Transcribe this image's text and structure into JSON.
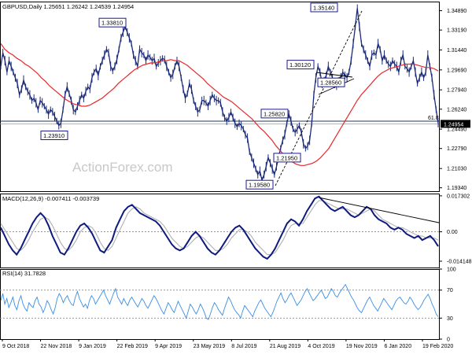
{
  "symbol_header": "GBPUSD,Daily  1.25651 1.26242 1.24539 1.24954",
  "watermark": "ActionForex.com",
  "colors": {
    "price": "#1c2b7a",
    "ma": "#e8272a",
    "macd": "#0d1a80",
    "signal": "#b0b0b0",
    "rsi": "#3a8ee6",
    "trendline": "#000000",
    "level_line": "#1c3a5a"
  },
  "chart_data": [
    {
      "type": "line",
      "pane": "price",
      "x_labels": [
        "9 Oct 2018",
        "22 Nov 2018",
        "9 Jan 2019",
        "22 Feb 2019",
        "9 Apr 2019",
        "23 May 2019",
        "8 Jul 2019",
        "21 Aug 2019",
        "4 Oct 2019",
        "19 Nov 2019",
        "6 Jan 2020",
        "19 Feb 2020"
      ],
      "y_ticks": [
        1.3489,
        1.3319,
        1.3144,
        1.2969,
        1.2794,
        1.2624,
        1.2449,
        1.2279,
        1.2103,
        1.1934
      ],
      "y_tick_labels": [
        "1.34890",
        "1.33190",
        "1.31440",
        "1.29690",
        "1.27940",
        "1.26240",
        "1.24490",
        "1.22790",
        "1.21030",
        "1.19340"
      ],
      "ylim": [
        1.1904,
        1.3569
      ],
      "current_price": "1.24954",
      "current_value": 1.24954,
      "series": [
        {
          "name": "",
          "values": [
            1.3,
            1.312,
            1.305,
            1.295,
            1.305,
            1.3,
            1.295,
            1.29,
            1.285,
            1.275,
            1.28,
            1.288,
            1.282,
            1.278,
            1.275,
            1.27,
            1.272,
            1.268,
            1.262,
            1.27,
            1.268,
            1.265,
            1.262,
            1.258,
            1.262,
            1.26,
            1.256,
            1.252,
            1.248,
            1.25,
            1.262,
            1.275,
            1.282,
            1.276,
            1.27,
            1.262,
            1.26,
            1.265,
            1.27,
            1.275,
            1.272,
            1.278,
            1.282,
            1.28,
            1.29,
            1.295,
            1.298,
            1.292,
            1.3,
            1.305,
            1.31,
            1.315,
            1.312,
            1.3,
            1.296,
            1.3,
            1.306,
            1.315,
            1.325,
            1.33,
            1.335,
            1.33,
            1.325,
            1.32,
            1.31,
            1.305,
            1.3,
            1.315,
            1.312,
            1.31,
            1.305,
            1.31,
            1.308,
            1.305,
            1.307,
            1.3,
            1.303,
            1.305,
            1.307,
            1.306,
            1.3,
            1.295,
            1.29,
            1.293,
            1.3,
            1.305,
            1.3,
            1.29,
            1.28,
            1.272,
            1.276,
            1.285,
            1.28,
            1.27,
            1.265,
            1.26,
            1.262,
            1.27,
            1.27,
            1.268,
            1.265,
            1.27,
            1.275,
            1.272,
            1.27,
            1.27,
            1.268,
            1.26,
            1.255,
            1.252,
            1.255,
            1.26,
            1.255,
            1.25,
            1.247,
            1.25,
            1.248,
            1.245,
            1.24,
            1.237,
            1.225,
            1.22,
            1.215,
            1.21,
            1.205,
            1.208,
            1.2,
            1.205,
            1.212,
            1.22,
            1.215,
            1.21,
            1.205,
            1.212,
            1.22,
            1.228,
            1.235,
            1.24,
            1.25,
            1.258,
            1.252,
            1.245,
            1.242,
            1.245,
            1.248,
            1.242,
            1.232,
            1.228,
            1.23,
            1.235,
            1.25,
            1.275,
            1.29,
            1.3,
            1.295,
            1.285,
            1.288,
            1.292,
            1.3,
            1.295,
            1.29,
            1.285,
            1.282,
            1.285,
            1.29,
            1.295,
            1.292,
            1.29,
            1.295,
            1.305,
            1.32,
            1.335,
            1.351,
            1.335,
            1.32,
            1.315,
            1.31,
            1.305,
            1.3,
            1.31,
            1.312,
            1.31,
            1.32,
            1.315,
            1.305,
            1.31,
            1.305,
            1.302,
            1.3,
            1.305,
            1.302,
            1.3,
            1.295,
            1.305,
            1.31,
            1.3,
            1.298,
            1.295,
            1.3,
            1.305,
            1.295,
            1.285,
            1.29,
            1.295,
            1.29,
            1.295,
            1.31,
            1.3,
            1.29,
            1.275,
            1.262,
            1.25
          ]
        },
        {
          "name": "",
          "values": [
            1.32,
            1.315,
            1.312,
            1.31,
            1.307,
            1.305,
            1.302,
            1.3,
            1.297,
            1.294,
            1.29,
            1.287,
            1.283,
            1.28,
            1.277,
            1.274,
            1.271,
            1.269,
            1.267,
            1.266,
            1.265,
            1.265,
            1.266,
            1.268,
            1.27,
            1.272,
            1.275,
            1.278,
            1.281,
            1.285,
            1.288,
            1.291,
            1.294,
            1.297,
            1.299,
            1.301,
            1.302,
            1.303,
            1.303,
            1.304,
            1.305,
            1.305,
            1.306,
            1.305,
            1.305,
            1.303,
            1.301,
            1.298,
            1.295,
            1.292,
            1.289,
            1.285,
            1.282,
            1.279,
            1.276,
            1.273,
            1.271,
            1.269,
            1.266,
            1.263,
            1.26,
            1.257,
            1.254,
            1.25,
            1.246,
            1.243,
            1.239,
            1.235,
            1.23,
            1.226,
            1.222,
            1.219,
            1.216,
            1.214,
            1.213,
            1.213,
            1.214,
            1.215,
            1.217,
            1.22,
            1.224,
            1.228,
            1.234,
            1.24,
            1.246,
            1.252,
            1.258,
            1.264,
            1.27,
            1.275,
            1.279,
            1.283,
            1.287,
            1.291,
            1.294,
            1.296,
            1.298,
            1.299,
            1.3,
            1.301,
            1.302,
            1.302,
            1.302,
            1.301,
            1.3,
            1.299,
            1.299,
            1.298,
            1.296
          ]
        }
      ],
      "callouts": [
        {
          "label": "1.33810",
          "value": 1.3381
        },
        {
          "label": "1.23910",
          "value": 1.2391
        },
        {
          "label": "1.35140",
          "value": 1.3514
        },
        {
          "label": "1.30120",
          "value": 1.3012
        },
        {
          "label": "1.28560",
          "value": 1.2856
        },
        {
          "label": "1.25820",
          "value": 1.2582
        },
        {
          "label": "1.21950",
          "value": 1.2195
        },
        {
          "label": "1.19580",
          "value": 1.1958
        }
      ],
      "fib_label": "61.8",
      "level_value": 1.2582
    },
    {
      "type": "line",
      "pane": "macd",
      "title": "MACD(12,26,9) -0.007411 -0.003739",
      "ylim": [
        -0.0172,
        0.0184
      ],
      "y_ticks": [
        0.017302,
        0.0,
        -0.014148
      ],
      "y_tick_labels": [
        "0.017302",
        "0.00",
        "-0.014148"
      ],
      "series": [
        {
          "name": "",
          "values": [
            0.002,
            -0.002,
            -0.006,
            -0.009,
            -0.011,
            -0.008,
            -0.004,
            0.0,
            0.004,
            0.007,
            0.009,
            0.007,
            0.003,
            -0.002,
            -0.006,
            -0.01,
            -0.011,
            -0.008,
            -0.004,
            0.0,
            0.003,
            0.004,
            0.002,
            -0.001,
            -0.005,
            -0.009,
            -0.01,
            -0.007,
            -0.004,
            0.002,
            0.006,
            0.01,
            0.012,
            0.013,
            0.011,
            0.009,
            0.008,
            0.007,
            0.006,
            0.005,
            0.003,
            0.0,
            -0.003,
            -0.006,
            -0.008,
            -0.009,
            -0.008,
            -0.005,
            -0.002,
            0.0,
            -0.002,
            -0.005,
            -0.008,
            -0.01,
            -0.011,
            -0.009,
            -0.006,
            -0.003,
            0.0,
            0.002,
            0.003,
            0.001,
            -0.002,
            -0.005,
            -0.008,
            -0.01,
            -0.012,
            -0.013,
            -0.011,
            -0.008,
            -0.004,
            0.0,
            0.004,
            0.006,
            0.005,
            0.003,
            0.006,
            0.01,
            0.013,
            0.016,
            0.017,
            0.015,
            0.013,
            0.011,
            0.01,
            0.011,
            0.012,
            0.01,
            0.008,
            0.007,
            0.008,
            0.01,
            0.012,
            0.011,
            0.008,
            0.006,
            0.005,
            0.004,
            0.002,
            0.001,
            0.002,
            0.001,
            -0.001,
            -0.002,
            -0.003,
            -0.002,
            -0.004,
            -0.003,
            -0.002,
            -0.004,
            -0.007
          ]
        },
        {
          "name": "",
          "values": [
            0.004,
            0.001,
            -0.002,
            -0.005,
            -0.008,
            -0.009,
            -0.007,
            -0.004,
            0.0,
            0.003,
            0.006,
            0.007,
            0.006,
            0.003,
            -0.001,
            -0.005,
            -0.008,
            -0.009,
            -0.007,
            -0.004,
            0.0,
            0.002,
            0.003,
            0.002,
            -0.001,
            -0.005,
            -0.008,
            -0.009,
            -0.007,
            -0.003,
            0.001,
            0.005,
            0.009,
            0.011,
            0.012,
            0.011,
            0.009,
            0.008,
            0.007,
            0.006,
            0.005,
            0.003,
            0.0,
            -0.003,
            -0.005,
            -0.007,
            -0.008,
            -0.007,
            -0.005,
            -0.003,
            -0.002,
            -0.003,
            -0.005,
            -0.007,
            -0.009,
            -0.009,
            -0.008,
            -0.006,
            -0.003,
            -0.001,
            0.001,
            0.001,
            0.0,
            -0.002,
            -0.005,
            -0.007,
            -0.009,
            -0.011,
            -0.011,
            -0.01,
            -0.007,
            -0.004,
            0.0,
            0.003,
            0.004,
            0.004,
            0.004,
            0.007,
            0.01,
            0.013,
            0.015,
            0.015,
            0.014,
            0.013,
            0.012,
            0.011,
            0.011,
            0.011,
            0.01,
            0.009,
            0.008,
            0.009,
            0.01,
            0.011,
            0.01,
            0.008,
            0.006,
            0.005,
            0.004,
            0.003,
            0.002,
            0.002,
            0.001,
            0.0,
            -0.001,
            -0.002,
            -0.002,
            -0.003,
            -0.003,
            -0.003,
            -0.004
          ]
        }
      ]
    },
    {
      "type": "line",
      "pane": "rsi",
      "title": "RSI(14) 31.7828",
      "ylim": [
        0,
        100
      ],
      "y_ticks": [
        100,
        70,
        30,
        0
      ],
      "y_tick_labels": [
        "100",
        "70",
        "30",
        "0"
      ],
      "series": [
        {
          "name": "",
          "values": [
            55,
            65,
            50,
            58,
            45,
            52,
            60,
            48,
            42,
            55,
            62,
            50,
            44,
            40,
            52,
            48,
            45,
            55,
            60,
            50,
            46,
            38,
            45,
            55,
            50,
            42,
            36,
            45,
            58,
            65,
            60,
            52,
            58,
            62,
            55,
            50,
            48,
            60,
            68,
            58,
            52,
            46,
            50,
            44,
            55,
            62,
            58,
            50,
            55,
            60,
            65,
            70,
            62,
            56,
            50,
            58,
            66,
            72,
            60,
            55,
            50,
            58,
            52,
            48,
            56,
            60,
            55,
            50,
            46,
            52,
            58,
            54,
            48,
            44,
            50,
            56,
            62,
            58,
            52,
            46,
            40,
            36,
            44,
            52,
            48,
            42,
            38,
            46,
            54,
            48,
            42,
            36,
            30,
            40,
            50,
            46,
            40,
            36,
            42,
            50,
            45,
            38,
            30,
            28,
            36,
            45,
            52,
            48,
            42,
            38,
            34,
            44,
            52,
            60,
            55,
            48,
            42,
            38,
            35,
            30,
            40,
            48,
            44,
            40,
            36,
            32,
            40,
            46,
            52,
            56,
            50,
            44,
            40,
            36,
            32,
            38,
            46,
            54,
            60,
            66,
            58,
            52,
            56,
            62,
            66,
            60,
            54,
            48,
            52,
            56,
            62,
            68,
            72,
            66,
            60,
            55,
            58,
            62,
            66,
            70,
            64,
            58,
            60,
            66,
            72,
            68,
            62,
            60,
            66,
            70,
            74,
            78,
            72,
            66,
            60,
            56,
            50,
            44,
            40,
            38,
            44,
            50,
            56,
            60,
            54,
            48,
            44,
            40,
            46,
            52,
            58,
            54,
            50,
            46,
            42,
            48,
            54,
            58,
            60,
            56,
            52,
            50,
            54,
            60,
            56,
            50,
            46,
            42,
            45,
            50,
            56,
            60,
            64,
            58,
            50,
            44,
            36,
            32
          ]
        }
      ]
    }
  ]
}
